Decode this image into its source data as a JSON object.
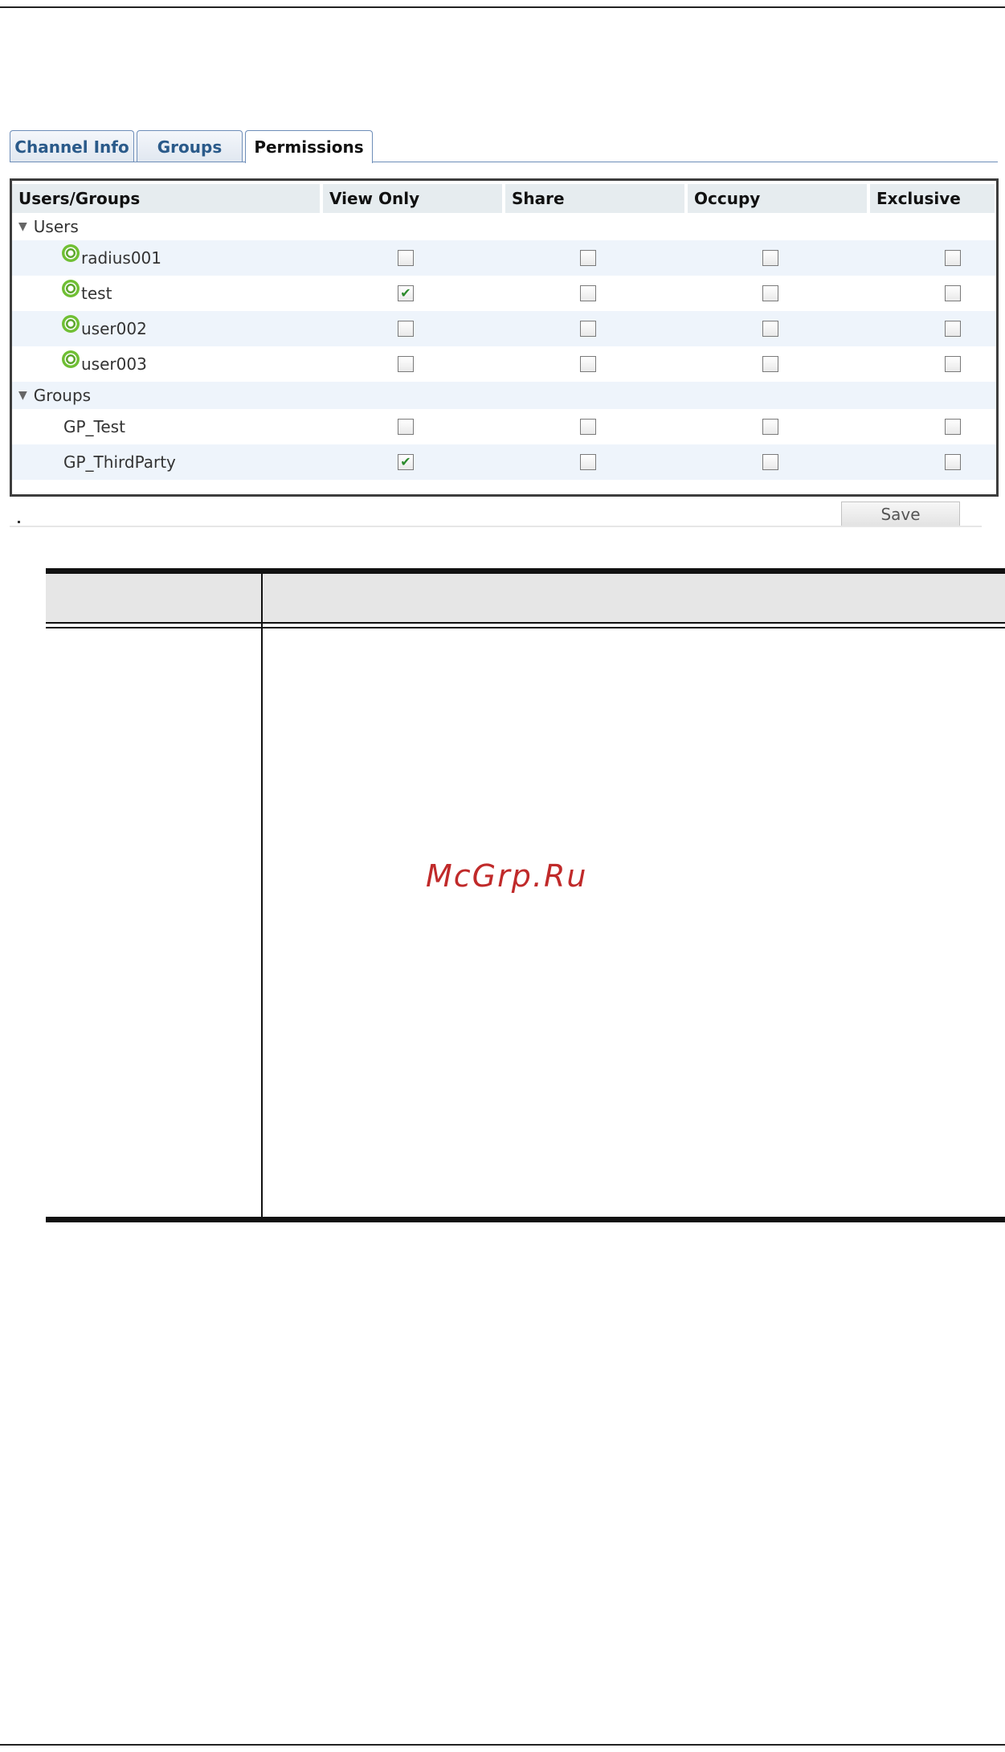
{
  "tabs": [
    {
      "label": "Channel Info",
      "active": false
    },
    {
      "label": "Groups",
      "active": false
    },
    {
      "label": "Permissions",
      "active": true
    }
  ],
  "table": {
    "headers": [
      "Users/Groups",
      "View Only",
      "Share",
      "Occupy",
      "Exclusive"
    ],
    "users_label": "Users",
    "groups_label": "Groups",
    "users": [
      {
        "name": "radius001",
        "view_only": false,
        "share": false,
        "occupy": false,
        "exclusive": false
      },
      {
        "name": "test",
        "view_only": true,
        "share": false,
        "occupy": false,
        "exclusive": false
      },
      {
        "name": "user002",
        "view_only": false,
        "share": false,
        "occupy": false,
        "exclusive": false
      },
      {
        "name": "user003",
        "view_only": false,
        "share": false,
        "occupy": false,
        "exclusive": false
      }
    ],
    "groups": [
      {
        "name": "GP_Test",
        "view_only": false,
        "share": false,
        "occupy": false,
        "exclusive": false
      },
      {
        "name": "GP_ThirdParty",
        "view_only": true,
        "share": false,
        "occupy": false,
        "exclusive": false
      }
    ]
  },
  "save_label": "Save",
  "watermark": "McGrp.Ru",
  "icons": {
    "expand": "triangle-down-icon",
    "user": "user-status-icon",
    "check": "check-icon"
  },
  "colors": {
    "tab_text": "#2a5a8a",
    "check": "#2b8a2b",
    "watermark": "#c02a2a",
    "user_icon": "#6fbf33"
  }
}
